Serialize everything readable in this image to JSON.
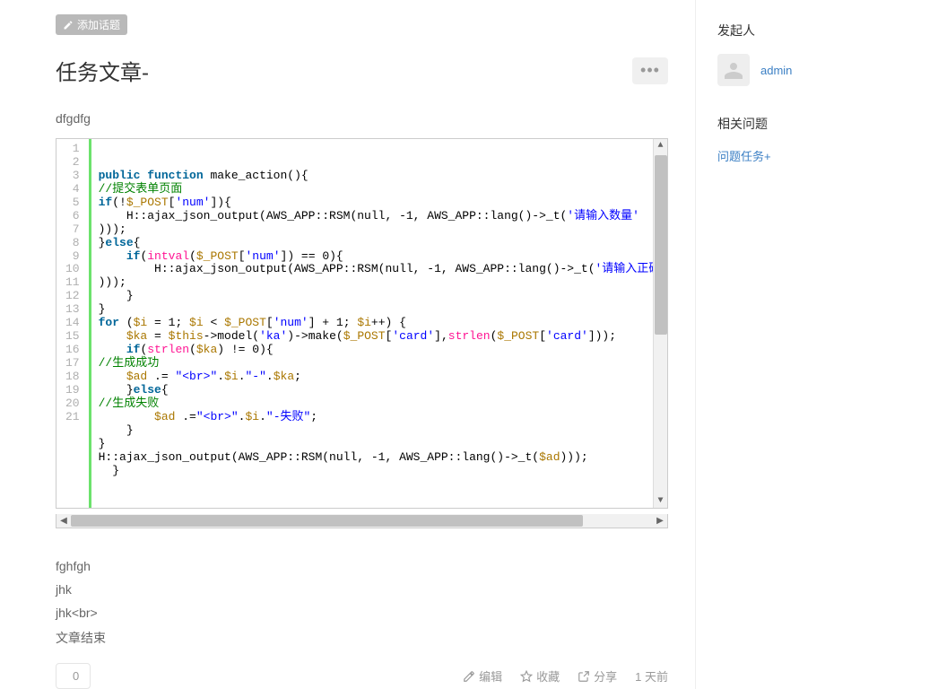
{
  "tag_button": {
    "label": "添加话题"
  },
  "title": "任务文章-",
  "content_intro": "dfgdfg",
  "post_lines": [
    "fghfgh",
    "jhk",
    "jhk<br>",
    "文章结束"
  ],
  "actions": {
    "like_count": "0",
    "edit": "编辑",
    "favorite": "收藏",
    "share": "分享",
    "time": "1 天前"
  },
  "sidebar": {
    "initiator_title": "发起人",
    "initiator_name": "admin",
    "related_title": "相关问题",
    "related_link": "问题任务+"
  },
  "code": {
    "line_count": 21,
    "lines": [
      {
        "tokens": [
          [
            "kw",
            "public"
          ],
          [
            "pln",
            " "
          ],
          [
            "kw",
            "function"
          ],
          [
            "pln",
            " make_action(){"
          ]
        ]
      },
      {
        "tokens": [
          [
            "cmt",
            "//提交表单页面"
          ]
        ]
      },
      {
        "tokens": [
          [
            "kw",
            "if"
          ],
          [
            "pln",
            "(!"
          ],
          [
            "var",
            "$_POST"
          ],
          [
            "pln",
            "["
          ],
          [
            "str",
            "'num'"
          ],
          [
            "pln",
            "]){"
          ]
        ]
      },
      {
        "tokens": [
          [
            "pln",
            "    H::ajax_json_output(AWS_APP::RSM(null, -1, AWS_APP::lang()->_t("
          ],
          [
            "str",
            "'请输入数量'"
          ]
        ]
      },
      {
        "tokens": [
          [
            "pln",
            ")));"
          ]
        ]
      },
      {
        "tokens": [
          [
            "pln",
            "}"
          ],
          [
            "kw",
            "else"
          ],
          [
            "pln",
            "{"
          ]
        ]
      },
      {
        "tokens": [
          [
            "pln",
            "    "
          ],
          [
            "kw",
            "if"
          ],
          [
            "pln",
            "("
          ],
          [
            "fn",
            "intval"
          ],
          [
            "pln",
            "("
          ],
          [
            "var",
            "$_POST"
          ],
          [
            "pln",
            "["
          ],
          [
            "str",
            "'num'"
          ],
          [
            "pln",
            "]) == 0){"
          ]
        ]
      },
      {
        "tokens": [
          [
            "pln",
            "        H::ajax_json_output(AWS_APP::RSM(null, -1, AWS_APP::lang()->_t("
          ],
          [
            "str",
            "'请输入正确"
          ]
        ]
      },
      {
        "tokens": [
          [
            "pln",
            ")));"
          ]
        ]
      },
      {
        "tokens": [
          [
            "pln",
            "    }"
          ]
        ]
      },
      {
        "tokens": [
          [
            "pln",
            "}"
          ]
        ]
      },
      {
        "tokens": [
          [
            "kw",
            "for"
          ],
          [
            "pln",
            " ("
          ],
          [
            "var",
            "$i"
          ],
          [
            "pln",
            " = 1; "
          ],
          [
            "var",
            "$i"
          ],
          [
            "pln",
            " < "
          ],
          [
            "var",
            "$_POST"
          ],
          [
            "pln",
            "["
          ],
          [
            "str",
            "'num'"
          ],
          [
            "pln",
            "] + 1; "
          ],
          [
            "var",
            "$i"
          ],
          [
            "pln",
            "++) {"
          ]
        ]
      },
      {
        "tokens": [
          [
            "pln",
            "    "
          ],
          [
            "var",
            "$ka"
          ],
          [
            "pln",
            " = "
          ],
          [
            "var",
            "$this"
          ],
          [
            "pln",
            "->model("
          ],
          [
            "str",
            "'ka'"
          ],
          [
            "pln",
            ")->make("
          ],
          [
            "var",
            "$_POST"
          ],
          [
            "pln",
            "["
          ],
          [
            "str",
            "'card'"
          ],
          [
            "pln",
            "],"
          ],
          [
            "fn",
            "strlen"
          ],
          [
            "pln",
            "("
          ],
          [
            "var",
            "$_POST"
          ],
          [
            "pln",
            "["
          ],
          [
            "str",
            "'card'"
          ],
          [
            "pln",
            "]));"
          ]
        ]
      },
      {
        "tokens": [
          [
            "pln",
            "    "
          ],
          [
            "kw",
            "if"
          ],
          [
            "pln",
            "("
          ],
          [
            "fn",
            "strlen"
          ],
          [
            "pln",
            "("
          ],
          [
            "var",
            "$ka"
          ],
          [
            "pln",
            ") != 0){"
          ]
        ]
      },
      {
        "tokens": [
          [
            "cmt",
            "//生成成功"
          ]
        ]
      },
      {
        "tokens": [
          [
            "pln",
            "    "
          ],
          [
            "var",
            "$ad"
          ],
          [
            "pln",
            " .= "
          ],
          [
            "str",
            "\"<br>\""
          ],
          [
            "pln",
            "."
          ],
          [
            "var",
            "$i"
          ],
          [
            "pln",
            "."
          ],
          [
            "str",
            "\"-\""
          ],
          [
            "pln",
            "."
          ],
          [
            "var",
            "$ka"
          ],
          [
            "pln",
            ";"
          ]
        ]
      },
      {
        "tokens": [
          [
            "pln",
            "    }"
          ],
          [
            "kw",
            "else"
          ],
          [
            "pln",
            "{"
          ]
        ]
      },
      {
        "tokens": [
          [
            "cmt",
            "//生成失败"
          ]
        ]
      },
      {
        "tokens": [
          [
            "pln",
            "        "
          ],
          [
            "var",
            "$ad"
          ],
          [
            "pln",
            " .="
          ],
          [
            "str",
            "\"<br>\""
          ],
          [
            "pln",
            "."
          ],
          [
            "var",
            "$i"
          ],
          [
            "pln",
            "."
          ],
          [
            "str",
            "\"-失败\""
          ],
          [
            "pln",
            ";"
          ]
        ]
      },
      {
        "tokens": [
          [
            "pln",
            "    }"
          ]
        ]
      },
      {
        "tokens": [
          [
            "pln",
            "}"
          ]
        ]
      },
      {
        "tokens": [
          [
            "pln",
            "H::ajax_json_output(AWS_APP::RSM(null, -1, AWS_APP::lang()->_t("
          ],
          [
            "var",
            "$ad"
          ],
          [
            "pln",
            ")));"
          ]
        ]
      },
      {
        "tokens": [
          [
            "pln",
            "  }"
          ]
        ]
      }
    ]
  }
}
